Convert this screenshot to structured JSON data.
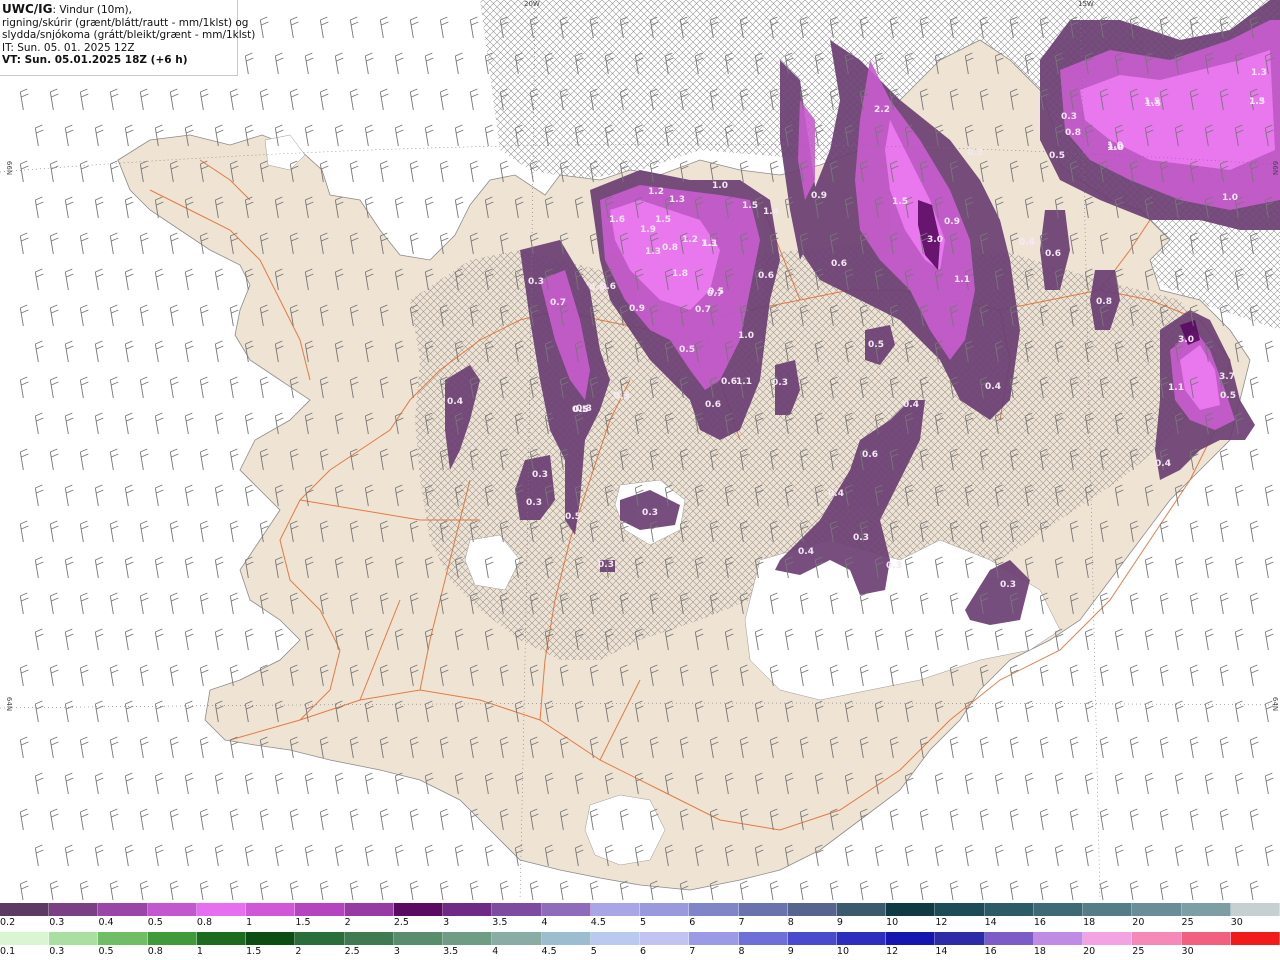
{
  "header": {
    "line1_bold": "UWC/IG",
    "line1_rest": ": Vindur (10m),",
    "line2": "rigning/skúrir (grænt/blátt/rautt - mm/1klst) og",
    "line3": "slydda/snjókoma (grátt/bleikt/grænt - mm/1klst)",
    "line4": "IT: Sun. 05. 01. 2025 12Z",
    "line5": "VT: Sun. 05.01.2025 18Z (+6 h)"
  },
  "grid_labels": {
    "lon_20w": "20W",
    "lon_15w": "15W",
    "lat_66n_left": "66N",
    "lat_66n_right": "66N",
    "lat_64n_left": "64N",
    "lat_64n_right": "64N"
  },
  "colors": {
    "land": "#efe3d3",
    "land_edge": "#8c8c8c",
    "roads": "#e06a2c",
    "hatch": "#7a7a7a",
    "ocean": "#ffffff"
  },
  "legend_snow": {
    "labels": [
      "0.2",
      "0.3",
      "0.4",
      "0.5",
      "0.8",
      "1",
      "1.5",
      "2",
      "2.5",
      "3",
      "3.5",
      "4",
      "4.5",
      "5",
      "6",
      "7",
      "8",
      "9",
      "10",
      "12",
      "14",
      "16",
      "18",
      "20",
      "25",
      "30"
    ],
    "colors": [
      "#5d3a63",
      "#7b3f86",
      "#9a46a8",
      "#c257cf",
      "#e56ff0",
      "#cf57d8",
      "#b444bf",
      "#973aa4",
      "#5a0a60",
      "#6e2a86",
      "#7d4ba1",
      "#8f6bbb",
      "#a8a6e6",
      "#9999dd",
      "#7f85c8",
      "#6b73ae",
      "#56648f",
      "#3c5a6e",
      "#0f3a44",
      "#1d4c59",
      "#2b5b67",
      "#3e6a75",
      "#557d87",
      "#6a8e98",
      "#7e9ea6",
      "#c7d0d1"
    ]
  },
  "legend_rain": {
    "labels": [
      "0.1",
      "0.3",
      "0.5",
      "0.8",
      "1",
      "1.5",
      "2",
      "2.5",
      "3",
      "3.5",
      "4",
      "4.5",
      "5",
      "6",
      "7",
      "8",
      "9",
      "10",
      "12",
      "14",
      "16",
      "18",
      "20",
      "25",
      "30"
    ],
    "colors": [
      "#d9f5d2",
      "#a9dfa0",
      "#6fbe66",
      "#3f9a3a",
      "#1d6b1f",
      "#0b4d12",
      "#2a6e3c",
      "#3f7a51",
      "#5a8d6c",
      "#6f9c84",
      "#89aca4",
      "#9cbcd0",
      "#b9c9ef",
      "#c2c2f3",
      "#9a9ae6",
      "#6f6fd8",
      "#4a4ace",
      "#2e2ebe",
      "#1515b0",
      "#2c2ca8",
      "#7d5cc7",
      "#c08be4",
      "#f3a3e2",
      "#f589b8",
      "#f26080",
      "#f21b1b"
    ]
  },
  "precip_labels": [
    {
      "t": "2.2"
    },
    {
      "t": "1.5"
    },
    {
      "t": "1.0"
    },
    {
      "t": "1.2"
    },
    {
      "t": "1.3"
    },
    {
      "t": "1.6"
    },
    {
      "t": "1.5"
    },
    {
      "t": "1.9"
    },
    {
      "t": "1.3"
    },
    {
      "t": "1.0"
    },
    {
      "t": "1.5"
    },
    {
      "t": "1.4"
    },
    {
      "t": "0.9"
    },
    {
      "t": "1.5"
    },
    {
      "t": "3.0"
    },
    {
      "t": "0.9"
    },
    {
      "t": "1.2"
    },
    {
      "t": "1.3"
    },
    {
      "t": "1.8"
    },
    {
      "t": "0.8"
    },
    {
      "t": "1.1"
    },
    {
      "t": "0.7"
    },
    {
      "t": "0.5"
    },
    {
      "t": "0.6"
    },
    {
      "t": "0.7"
    },
    {
      "t": "0.3"
    },
    {
      "t": "0.4"
    },
    {
      "t": "0.6"
    },
    {
      "t": "1.1"
    },
    {
      "t": "0.5"
    },
    {
      "t": "0.9"
    },
    {
      "t": "0.7"
    },
    {
      "t": "0.6"
    },
    {
      "t": "0.5"
    },
    {
      "t": "1.0"
    },
    {
      "t": "0.6"
    },
    {
      "t": "0.6"
    },
    {
      "t": "0.3"
    },
    {
      "t": "0.5"
    },
    {
      "t": "0.6"
    },
    {
      "t": "1.5"
    },
    {
      "t": "1.3"
    },
    {
      "t": "1.0"
    },
    {
      "t": "1.0"
    },
    {
      "t": "0.5"
    },
    {
      "t": "0.3"
    },
    {
      "t": "0.6"
    },
    {
      "t": "0.4"
    },
    {
      "t": "0.6"
    },
    {
      "t": "0.8"
    },
    {
      "t": "1.1"
    },
    {
      "t": "0.4"
    },
    {
      "t": "0.5"
    },
    {
      "t": "0.3"
    },
    {
      "t": "0.4"
    },
    {
      "t": "0.3"
    },
    {
      "t": "0.3"
    },
    {
      "t": "0.6"
    },
    {
      "t": "0.4"
    },
    {
      "t": "0.4"
    },
    {
      "t": "0.3"
    },
    {
      "t": "0.3"
    },
    {
      "t": "0.3"
    },
    {
      "t": "0.5"
    },
    {
      "t": "0.4"
    },
    {
      "t": "0.3"
    },
    {
      "t": "0.3"
    },
    {
      "t": "0.3"
    },
    {
      "t": "3.0"
    },
    {
      "t": "1.1"
    },
    {
      "t": "3.7"
    },
    {
      "t": "0.5"
    },
    {
      "t": "0.3"
    },
    {
      "t": "0.3"
    },
    {
      "t": "1.5"
    },
    {
      "t": "1.3"
    },
    {
      "t": "1.0"
    },
    {
      "t": "0.8"
    }
  ]
}
